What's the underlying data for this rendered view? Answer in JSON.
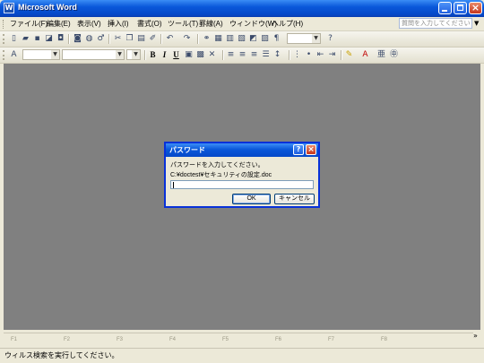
{
  "window": {
    "title": "Microsoft Word",
    "app_icon": "W"
  },
  "title_buttons": {
    "minimize": "minimize-icon",
    "maximize": "maximize-icon",
    "close": "×"
  },
  "menu": {
    "items": [
      "ファイル(F)",
      "編集(E)",
      "表示(V)",
      "挿入(I)",
      "書式(O)",
      "ツール(T)",
      "罫線(A)",
      "ウィンドウ(W)",
      "ヘルプ(H)"
    ],
    "help_placeholder": "質問を入力してください"
  },
  "toolbar1": {
    "icons": [
      "new-icon",
      "open-icon",
      "save-icon",
      "permission-icon",
      "research-icon",
      "print-icon",
      "print-preview-icon",
      "spelling-icon",
      "cut-icon",
      "copy-icon",
      "paste-icon",
      "format-painter-icon",
      "undo-icon",
      "redo-icon",
      "hyperlink-icon",
      "table-icon",
      "excel-icon",
      "columns-icon",
      "drawing-icon",
      "document-map-icon",
      "show-hide-icon",
      "zoom-icon",
      "help-icon"
    ]
  },
  "toolbar2": {
    "styles": [
      "B",
      "I",
      "U"
    ]
  },
  "fkeys": [
    "F1",
    "F2",
    "F3",
    "F4",
    "F5",
    "F6",
    "F7",
    "F8"
  ],
  "status": {
    "text": "ウィルス検索を実行してください。"
  },
  "dialog": {
    "title": "パスワード",
    "help_glyph": "?",
    "close_glyph": "×",
    "prompt": "パスワードを入力してください。",
    "path": "C:¥doctest¥セキュリティの設定.doc",
    "password_value": "",
    "ok_label": "OK",
    "cancel_label": "キャンセル"
  }
}
